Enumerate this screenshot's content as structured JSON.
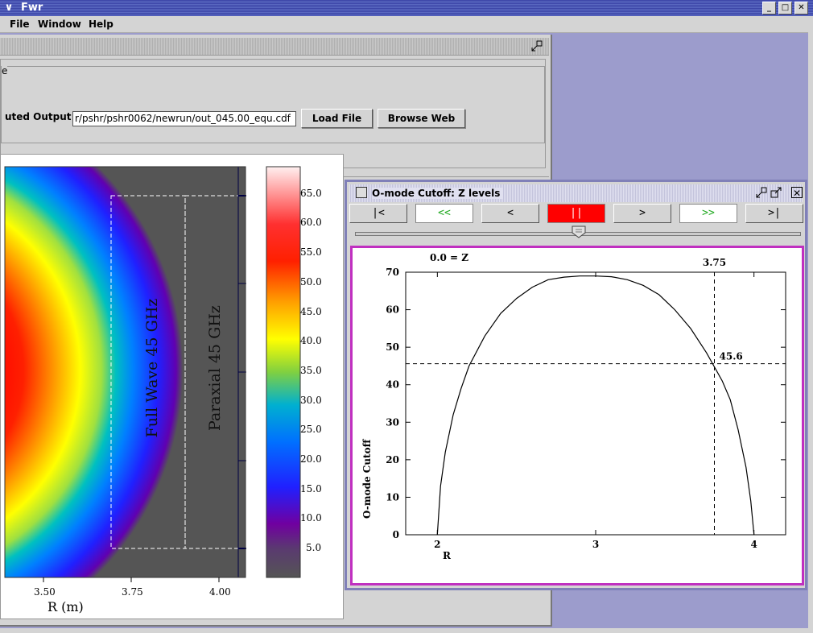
{
  "app": {
    "title": "Fwr"
  },
  "menu": {
    "file": "File",
    "window": "Window",
    "help": "Help"
  },
  "main_frame": {
    "group_label": "e",
    "output_label": "uted Output",
    "output_path": "r/pshr/pshr0062/newrun/out_045.00_equ.cdf",
    "load_button": "Load File",
    "browse_button": "Browse Web"
  },
  "colormap": {
    "labels": [
      "65.0",
      "60.0",
      "55.0",
      "50.0",
      "45.0",
      "40.0",
      "35.0",
      "30.0",
      "25.0",
      "20.0",
      "15.0",
      "10.0",
      "5.0"
    ],
    "x_ticks": [
      "3.50",
      "3.75",
      "4.00"
    ],
    "xlabel": "R (m)",
    "annot_full": "Full Wave 45 GHz",
    "annot_paraxial": "Paraxial 45 GHz"
  },
  "cutoff_window": {
    "title": "O-mode Cutoff:  Z levels",
    "buttons": {
      "first": "|<",
      "rewind": "<<",
      "prev": "<",
      "pause": "||",
      "next": ">",
      "ffwd": ">>",
      "last": ">|"
    },
    "slider_value": 0.5
  },
  "chart_data": {
    "type": "line",
    "z_label": "0.0   = Z",
    "xlabel": "R",
    "ylabel": "O-mode Cutoff",
    "xlim": [
      1.8,
      4.2
    ],
    "ylim": [
      0,
      70
    ],
    "x_ticks": [
      "2",
      "3",
      "4"
    ],
    "y_ticks": [
      "0",
      "10",
      "20",
      "30",
      "40",
      "50",
      "60",
      "70"
    ],
    "x": [
      2.0,
      2.02,
      2.05,
      2.1,
      2.15,
      2.2,
      2.3,
      2.4,
      2.5,
      2.6,
      2.7,
      2.8,
      2.9,
      3.0,
      3.1,
      3.2,
      3.3,
      3.4,
      3.5,
      3.6,
      3.7,
      3.8,
      3.85,
      3.9,
      3.95,
      3.98,
      4.0
    ],
    "y": [
      0,
      13,
      22,
      32,
      39,
      45,
      53,
      59,
      63,
      66,
      68,
      68.7,
      69,
      69,
      68.8,
      68,
      66.5,
      64,
      60,
      55,
      48.5,
      41,
      36,
      28,
      18,
      9,
      0
    ],
    "cursor_x": 3.75,
    "cursor_x_label": "3.75",
    "cursor_y": 45.6,
    "cursor_y_label": "45.6"
  }
}
